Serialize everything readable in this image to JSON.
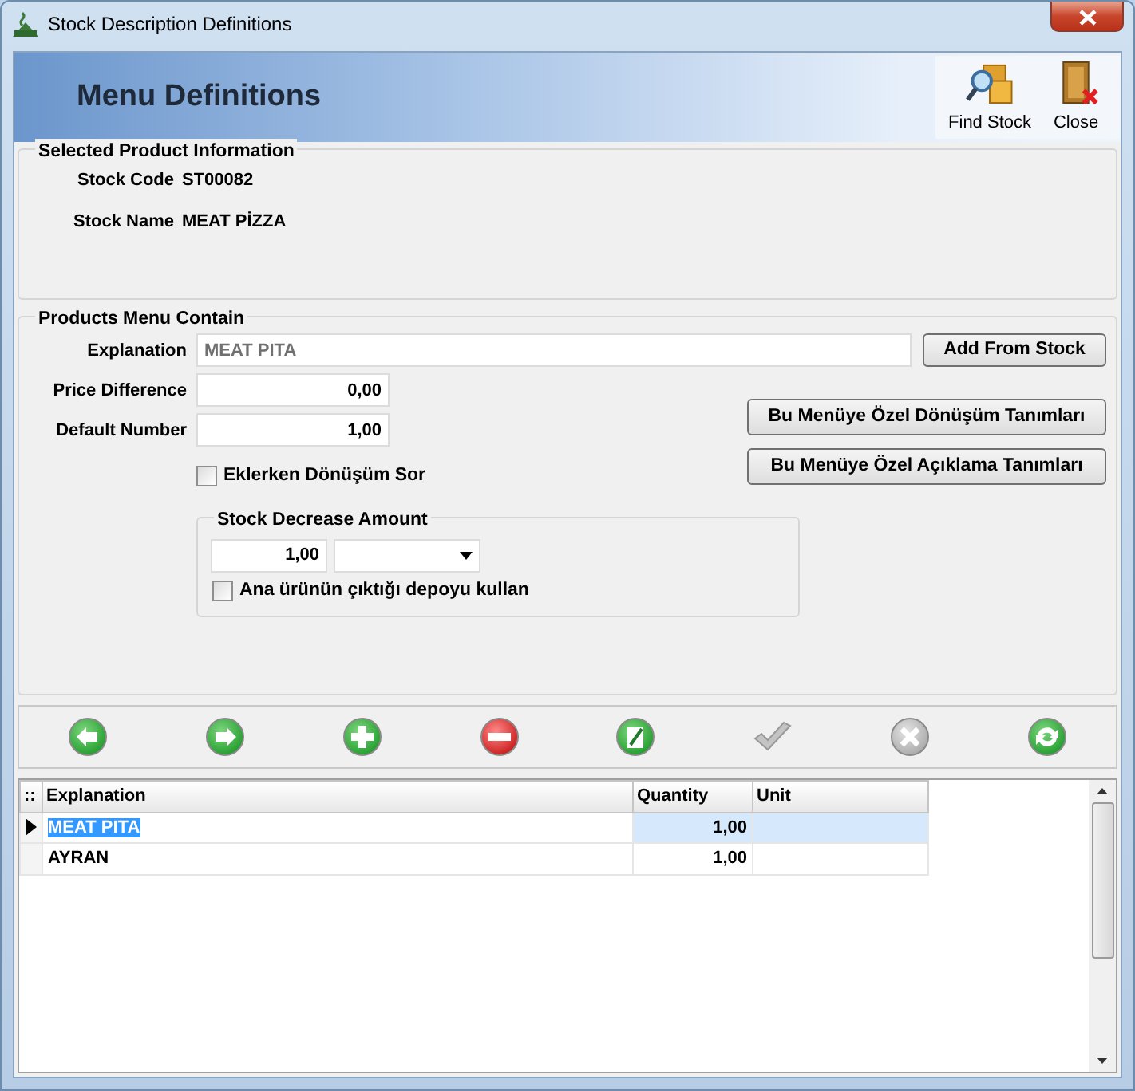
{
  "window": {
    "title": "Stock Description Definitions"
  },
  "header": {
    "title": "Menu Definitions",
    "actions": [
      {
        "kind": "find",
        "label": "Find Stock"
      },
      {
        "kind": "close",
        "label": "Close"
      }
    ]
  },
  "selected_product": {
    "title": "Selected Product Information",
    "fields": [
      {
        "label": "Stock Code",
        "value": "ST00082"
      },
      {
        "label": "Stock Name",
        "value": "MEAT PİZZA"
      }
    ]
  },
  "menu_contain": {
    "title": "Products Menu Contain",
    "explanation": {
      "label": "Explanation",
      "value": "MEAT PITA",
      "disabled": true
    },
    "add_button": "Add From Stock",
    "price_difference": {
      "label": "Price Difference",
      "value": "0,00"
    },
    "default_number": {
      "label": "Default Number",
      "value": "1,00"
    },
    "ask_conversion": {
      "label": "Eklerken Dönüşüm Sor",
      "checked": false
    },
    "side_buttons": [
      "Bu Menüye Özel Dönüşüm Tanımları",
      "Bu Menüye Özel Açıklama Tanımları"
    ],
    "decrease": {
      "title": "Stock Decrease Amount",
      "amount": "1,00",
      "use_main_depot": {
        "label": "Ana ürünün çıktığı depoyu kullan",
        "checked": false
      }
    }
  },
  "toolbar": [
    {
      "kind": "prev",
      "disabled": false
    },
    {
      "kind": "next",
      "disabled": false
    },
    {
      "kind": "add",
      "disabled": false
    },
    {
      "kind": "delete",
      "disabled": false
    },
    {
      "kind": "edit",
      "disabled": false
    },
    {
      "kind": "save",
      "disabled": true
    },
    {
      "kind": "cancel",
      "disabled": true
    },
    {
      "kind": "refresh",
      "disabled": false
    }
  ],
  "table": {
    "corner": "::",
    "columns": [
      "Explanation",
      "Quantity",
      "Unit"
    ],
    "rows": [
      {
        "explanation": "MEAT PITA",
        "quantity": "1,00",
        "selected": true
      },
      {
        "explanation": "AYRAN",
        "quantity": "1,00",
        "selected": false
      }
    ]
  }
}
